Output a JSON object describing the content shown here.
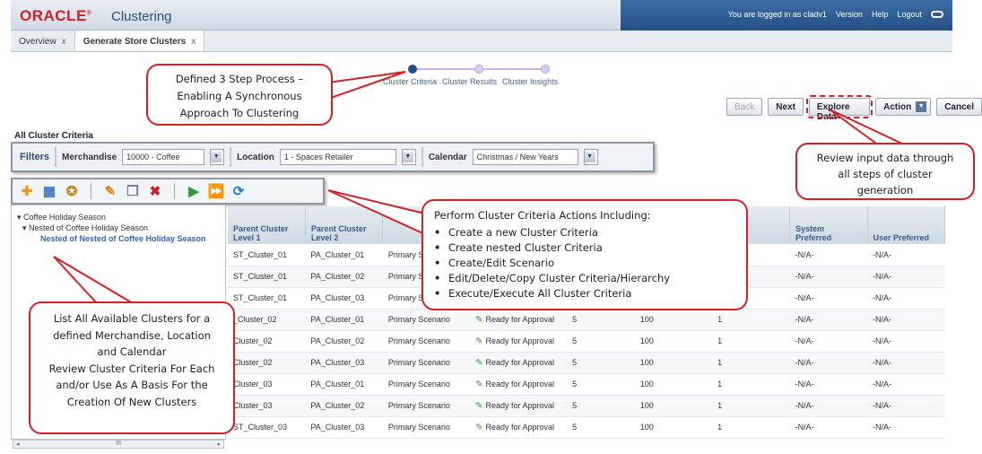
{
  "header": {
    "brand": "ORACLE",
    "app_title": "Clustering",
    "user_text": "You are logged in as cladv1",
    "links": [
      "Version",
      "Help",
      "Logout"
    ]
  },
  "tabs": [
    {
      "label": "Overview"
    },
    {
      "label": "Generate Store Clusters"
    }
  ],
  "train": {
    "steps": [
      "Cluster Criteria",
      "Cluster Results",
      "Cluster Insights"
    ]
  },
  "actions": {
    "back": "Back",
    "next": "Next",
    "explore": "Explore Data",
    "action": "Action",
    "cancel": "Cancel"
  },
  "section_title": "All Cluster Criteria",
  "filters": {
    "label": "Filters",
    "merchandise_label": "Merchandise",
    "merchandise_value": "10000 - Coffee",
    "location_label": "Location",
    "location_value": "1 - Spaces Retailer",
    "calendar_label": "Calendar",
    "calendar_value": "Christmas / New Years"
  },
  "tree": {
    "items": [
      "Coffee Holiday Season",
      "Nested of Coffee Holiday Season",
      "Nested of Nested of Coffee Holiday Season"
    ]
  },
  "table": {
    "headers": {
      "parent1": "Parent Cluster Level 1",
      "parent2": "Parent Cluster Level 2",
      "system": "System Preferred",
      "user": "User Preferred"
    },
    "rows": [
      {
        "c1": "ST_Cluster_01",
        "c2": "PA_Cluster_01",
        "scen": "Primary S",
        "status": "",
        "n": "",
        "pct": "",
        "v": "",
        "sys": "-N/A-",
        "usr": "-N/A-"
      },
      {
        "c1": "ST_Cluster_01",
        "c2": "PA_Cluster_02",
        "scen": "Primary S",
        "status": "",
        "n": "",
        "pct": "",
        "v": "",
        "sys": "-N/A-",
        "usr": "-N/A-"
      },
      {
        "c1": "ST_Cluster_01",
        "c2": "PA_Cluster_03",
        "scen": "Primary S",
        "status": "",
        "n": "",
        "pct": "",
        "v": "",
        "sys": "-N/A-",
        "usr": "-N/A-"
      },
      {
        "c1": "_Cluster_02",
        "c2": "PA_Cluster_01",
        "scen": "Primary Scenario",
        "status": "Ready for Approval",
        "n": "5",
        "pct": "100",
        "v": "1",
        "sys": "-N/A-",
        "usr": "-N/A-"
      },
      {
        "c1": "Cluster_02",
        "c2": "PA_Cluster_02",
        "scen": "Primary Scenario",
        "status": "Ready for Approval",
        "n": "5",
        "pct": "100",
        "v": "1",
        "sys": "-N/A-",
        "usr": "-N/A-"
      },
      {
        "c1": "Cluster_02",
        "c2": "PA_Cluster_03",
        "scen": "Primary Scenario",
        "status": "Ready for Approval",
        "n": "5",
        "pct": "100",
        "v": "1",
        "sys": "-N/A-",
        "usr": "-N/A-"
      },
      {
        "c1": "Cluster_03",
        "c2": "PA_Cluster_01",
        "scen": "Primary Scenario",
        "status": "Ready for Approval",
        "n": "5",
        "pct": "100",
        "v": "1",
        "sys": "-N/A-",
        "usr": "-N/A-"
      },
      {
        "c1": "Cluster_03",
        "c2": "PA_Cluster_02",
        "scen": "Primary Scenario",
        "status": "Ready for Approval",
        "n": "5",
        "pct": "100",
        "v": "1",
        "sys": "-N/A-",
        "usr": "-N/A-"
      },
      {
        "c1": "ST_Cluster_03",
        "c2": "PA_Cluster_03",
        "scen": "Primary Scenario",
        "status": "Ready for Approval",
        "n": "5",
        "pct": "100",
        "v": "1",
        "sys": "-N/A-",
        "usr": "-N/A-"
      }
    ]
  },
  "callouts": {
    "process": [
      "Defined 3 Step Process –",
      "Enabling A Synchronous",
      "Approach To Clustering"
    ],
    "explore": [
      "Review input data through",
      "all steps of cluster",
      "generation"
    ],
    "actions_title": "Perform Cluster Criteria Actions Including:",
    "actions_items": [
      "Create a new Cluster Criteria",
      "Create nested Cluster Criteria",
      "Create/Edit Scenario",
      "Edit/Delete/Copy  Cluster Criteria/Hierarchy",
      "Execute/Execute All Cluster Criteria"
    ],
    "list": [
      "List All Available Clusters for a",
      "defined Merchandise, Location",
      "and Calendar",
      "Review Cluster Criteria For Each",
      "and/or Use As A Basis For the",
      "Creation Of New Clusters"
    ]
  },
  "colors": {
    "brand_red": "#d41f26",
    "callout_border": "#d32027",
    "header_blue": "#224f86",
    "status_green": "#3a9a3a"
  },
  "icons": [
    "create-criteria-icon",
    "create-nested-icon",
    "scenario-icon",
    "edit-icon",
    "copy-icon",
    "delete-icon",
    "execute-icon",
    "execute-all-icon",
    "refresh-icon"
  ]
}
